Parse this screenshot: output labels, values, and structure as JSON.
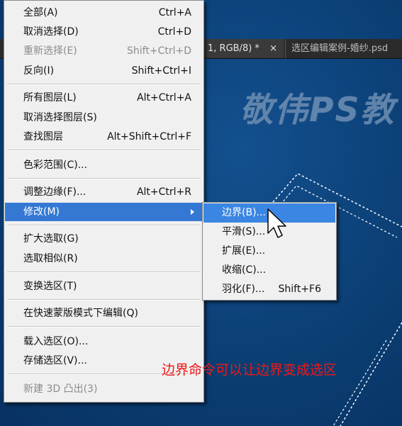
{
  "document_tabs": [
    {
      "label": "1, RGB/8) *",
      "close": "×"
    },
    {
      "label": "选区编辑案例-婚纱.psd"
    }
  ],
  "watermark": "敬伟PS教",
  "menu": {
    "items": [
      {
        "label": "全部(A)",
        "shortcut": "Ctrl+A"
      },
      {
        "label": "取消选择(D)",
        "shortcut": "Ctrl+D"
      },
      {
        "label": "重新选择(E)",
        "shortcut": "Shift+Ctrl+D",
        "disabled": true
      },
      {
        "label": "反向(I)",
        "shortcut": "Shift+Ctrl+I"
      },
      {
        "label": "所有图层(L)",
        "shortcut": "Alt+Ctrl+A"
      },
      {
        "label": "取消选择图层(S)",
        "shortcut": ""
      },
      {
        "label": "查找图层",
        "shortcut": "Alt+Shift+Ctrl+F"
      },
      {
        "label": "色彩范围(C)...",
        "shortcut": ""
      },
      {
        "label": "调整边缘(F)...",
        "shortcut": "Alt+Ctrl+R"
      },
      {
        "label": "修改(M)",
        "shortcut": "",
        "active": true
      },
      {
        "label": "扩大选取(G)",
        "shortcut": ""
      },
      {
        "label": "选取相似(R)",
        "shortcut": ""
      },
      {
        "label": "变换选区(T)",
        "shortcut": ""
      },
      {
        "label": "在快速蒙版模式下编辑(Q)",
        "shortcut": ""
      },
      {
        "label": "载入选区(O)...",
        "shortcut": ""
      },
      {
        "label": "存储选区(V)...",
        "shortcut": ""
      },
      {
        "label": "新建 3D 凸出(3)",
        "shortcut": "",
        "disabled": true
      }
    ]
  },
  "submenu": {
    "items": [
      {
        "label": "边界(B)...",
        "shortcut": "",
        "active": true
      },
      {
        "label": "平滑(S)...",
        "shortcut": ""
      },
      {
        "label": "扩展(E)...",
        "shortcut": ""
      },
      {
        "label": "收缩(C)...",
        "shortcut": ""
      },
      {
        "label": "羽化(F)...",
        "shortcut": "Shift+F6"
      }
    ]
  },
  "caption": "边界命令可以让边界变成选区",
  "colors": {
    "highlight": "#3478d4",
    "caption": "#f01818",
    "canvas": "#0b3e73"
  }
}
